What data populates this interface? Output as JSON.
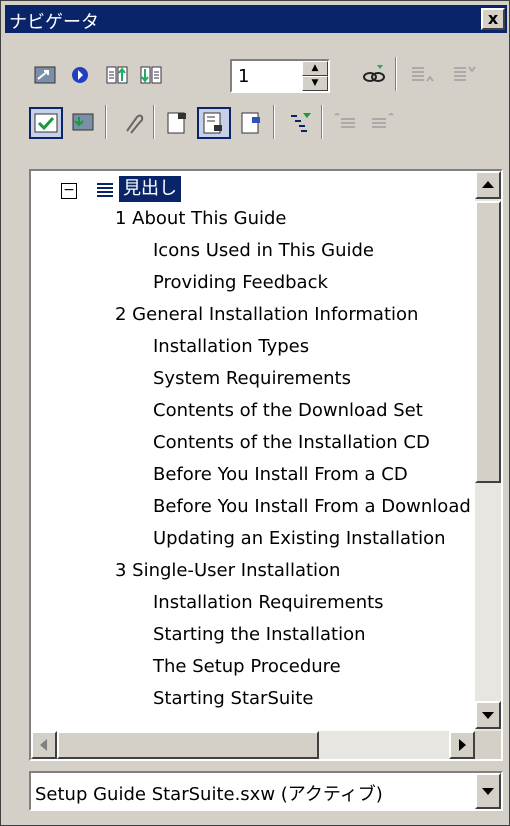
{
  "window": {
    "title": "ナビゲータ",
    "close_label": "x"
  },
  "toolbar": {
    "page_number": "1",
    "row1_icons": [
      "toggle-icon",
      "navigation-icon",
      "previous-icon",
      "next-icon",
      "link-icon",
      "promote-chapter-icon",
      "demote-chapter-icon"
    ],
    "row2_icons": [
      "content-view-icon",
      "list-box-icon",
      "reminder-icon",
      "header-icon",
      "footer-icon",
      "anchor-icon",
      "heading-levels-icon",
      "promote-level-icon",
      "demote-level-icon"
    ]
  },
  "tree": {
    "root_label": "見出し",
    "items": [
      {
        "level": 1,
        "label": "1 About This Guide"
      },
      {
        "level": 2,
        "label": "Icons Used in This Guide"
      },
      {
        "level": 2,
        "label": "Providing Feedback"
      },
      {
        "level": 1,
        "label": "2 General Installation Information"
      },
      {
        "level": 2,
        "label": "Installation Types"
      },
      {
        "level": 2,
        "label": "System Requirements"
      },
      {
        "level": 2,
        "label": "Contents of the Download Set"
      },
      {
        "level": 2,
        "label": "Contents of the Installation CD"
      },
      {
        "level": 2,
        "label": "Before You Install From a CD"
      },
      {
        "level": 2,
        "label": "Before You Install From a Download"
      },
      {
        "level": 2,
        "label": "Updating an Existing Installation"
      },
      {
        "level": 1,
        "label": "3 Single-User Installation"
      },
      {
        "level": 2,
        "label": "Installation Requirements"
      },
      {
        "level": 2,
        "label": "Starting the Installation"
      },
      {
        "level": 2,
        "label": "The Setup Procedure"
      },
      {
        "level": 2,
        "label": "Starting StarSuite"
      }
    ]
  },
  "document_select": {
    "value": "Setup Guide StarSuite.sxw (アクティブ)"
  },
  "colors": {
    "selection": "#0a246a",
    "face": "#d4d0c8",
    "title_bar": "#0a246a"
  }
}
